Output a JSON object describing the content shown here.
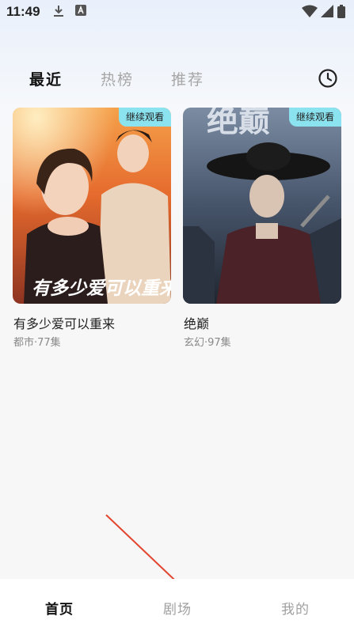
{
  "status_bar": {
    "time": "11:49",
    "left_icons": [
      "download-icon",
      "app-a-icon"
    ],
    "right_icons": [
      "wifi-icon",
      "signal-icon",
      "battery-icon"
    ]
  },
  "tabs": [
    {
      "label": "最近",
      "active": true
    },
    {
      "label": "热榜",
      "active": false
    },
    {
      "label": "推荐",
      "active": false
    }
  ],
  "history_icon": "clock-icon",
  "cards": [
    {
      "badge": "继续观看",
      "title": "有多少爱可以重来",
      "meta": "都市·77集",
      "poster_text": "有多少爱可以重来",
      "colors": {
        "top": "#f08a3a",
        "mid": "#e2672c",
        "bottom": "#a9402a"
      }
    },
    {
      "badge": "继续观看",
      "title": "绝巅",
      "meta": "玄幻·97集",
      "poster_text": "绝巅",
      "colors": {
        "top": "#5c6e85",
        "mid": "#3f4c5f",
        "bottom": "#232a36"
      }
    }
  ],
  "bottom_nav": [
    {
      "label": "首页",
      "active": true
    },
    {
      "label": "剧场",
      "active": false
    },
    {
      "label": "我的",
      "active": false
    }
  ],
  "annotation_color": "#e2462f"
}
